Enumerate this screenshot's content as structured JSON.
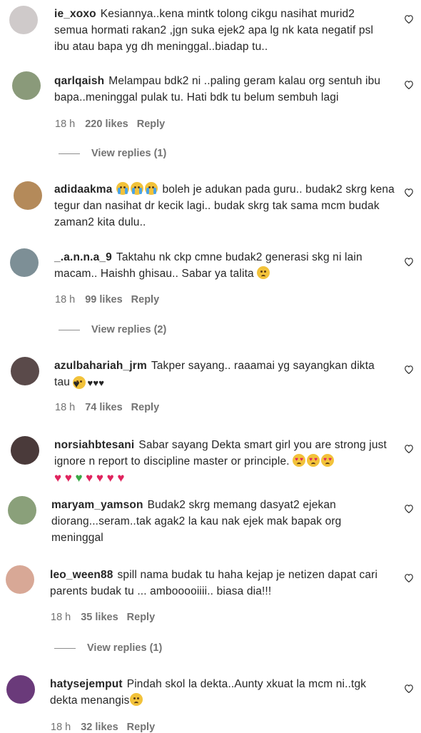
{
  "comments": [
    {
      "username": "ie_xoxo",
      "text": "Kesiannya..kena mintk tolong cikgu nasihat murid2 semua hormati rakan2 ,jgn suka ejek2 apa lg nk kata negatif psl ibu atau bapa yg dh meninggal..biadap tu..",
      "avatar_color": "#cfcaca"
    },
    {
      "username": "qarlqaish",
      "text": "Melampau bdk2 ni ..paling geram kalau org sentuh ibu bapa..meninggal pulak tu. Hati bdk tu belum sembuh lagi",
      "time": "18 h",
      "likes": "220 likes",
      "reply": "Reply",
      "view_replies": "View replies (1)",
      "avatar_color": "#8a9a7a"
    },
    {
      "username": "adidaakma",
      "text": "boleh je adukan pada guru.. budak2 skrg kena tegur dan nasihat dr kecik lagi.. budak skrg tak sama mcm budak zaman2 kita dulu..",
      "avatar_color": "#b48a5a"
    },
    {
      "username": "_.a.n.n.a_9",
      "text": "Taktahu nk ckp cmne budak2 generasi skg ni lain macam.. Haishh ghisau.. Sabar ya talita",
      "time": "18 h",
      "likes": "99 likes",
      "reply": "Reply",
      "view_replies": "View replies (2)",
      "avatar_color": "#7d8f96"
    },
    {
      "username": "azulbahariah_jrm",
      "text": "Takper sayang.. raaamai yg sayangkan dikta tau",
      "time": "18 h",
      "likes": "74 likes",
      "reply": "Reply",
      "avatar_color": "#5a4a4a"
    },
    {
      "username": "norsiahbtesani",
      "text": "Sabar sayang Dekta smart girl you are strong just ignore n report to discipline master or principle.",
      "avatar_color": "#4a3a3a"
    },
    {
      "username": "maryam_yamson",
      "text": "Budak2 skrg memang dasyat2 ejekan diorang...seram..tak agak2 la kau nak ejek mak bapak org meninggal",
      "avatar_color": "#8aa07a"
    },
    {
      "username": "leo_ween88",
      "text": "spill nama budak tu haha kejap je netizen dapat cari parents budak tu ... ambooooiiii.. biasa dia!!!",
      "time": "18 h",
      "likes": "35 likes",
      "reply": "Reply",
      "view_replies": "View replies (1)",
      "avatar_color": "#d8a896"
    },
    {
      "username": "hatysejemput",
      "text": "Pindah skol la dekta..Aunty xkuat la mcm ni..tgk dekta menangis",
      "time": "18 h",
      "likes": "32 likes",
      "reply": "Reply",
      "avatar_color": "#6a3a7a"
    }
  ],
  "icons": {
    "like": "heart-outline-icon",
    "sad": "sad-face-emoji",
    "sob": "crying-face-emoji",
    "kiss": "kissing-face-emoji",
    "heart_eyes": "heart-eyes-emoji"
  }
}
